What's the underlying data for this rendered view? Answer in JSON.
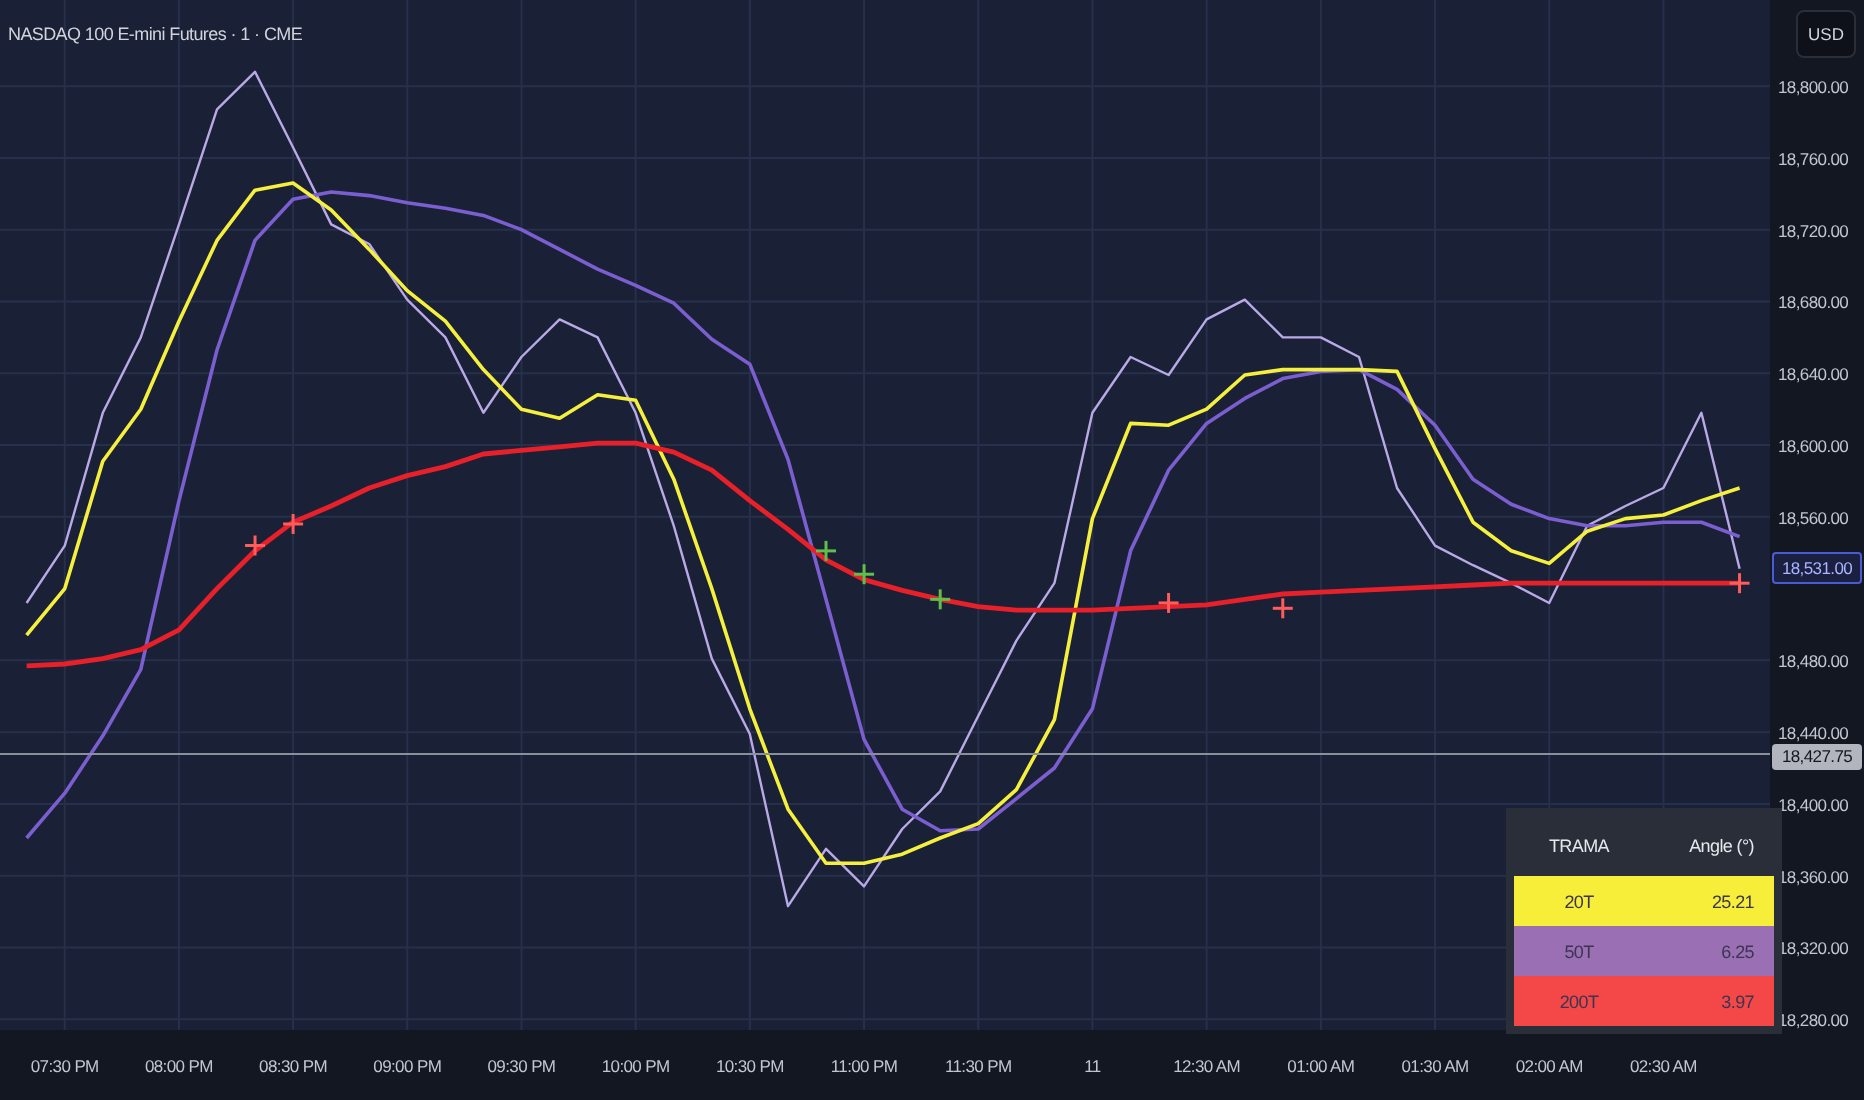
{
  "chart": {
    "title": "NASDAQ 100 E-mini Futures · 1 · CME",
    "currency_button": "USD",
    "chart_data": {
      "type": "line",
      "categories": [
        null,
        "07:30 PM",
        null,
        null,
        "08:00 PM",
        null,
        null,
        "08:30 PM",
        null,
        null,
        "09:00 PM",
        null,
        null,
        "09:30 PM",
        null,
        null,
        "10:00 PM",
        null,
        null,
        "10:30 PM",
        null,
        null,
        "11:00 PM",
        null,
        null,
        "11:30 PM",
        null,
        null,
        "11",
        null,
        null,
        "12:30 AM",
        null,
        null,
        "01:00 AM",
        null,
        null,
        "01:30 AM",
        null,
        null,
        "02:00 AM",
        null,
        null,
        "02:30 AM",
        null,
        null
      ],
      "series": [
        {
          "color": "#b9a9e6",
          "values": [
            18512,
            18544,
            18618,
            18660,
            18723,
            18787,
            18808,
            18766,
            18723,
            18712,
            18681,
            18660,
            18618,
            18649,
            18670,
            18660,
            18618,
            18555,
            18481,
            18439,
            18343,
            18375,
            18354,
            18386,
            18407,
            18449,
            18491,
            18523,
            18618,
            18649,
            18639,
            18670,
            18681,
            18660,
            18660,
            18649,
            18576,
            18544,
            18533,
            18523,
            18512,
            18555,
            18566,
            18576,
            18618,
            18531
          ]
        },
        {
          "color": "#7b5fd0",
          "values": [
            18381,
            18406,
            18438,
            18475,
            18569,
            18653,
            18714,
            18737,
            18741,
            18739,
            18735,
            18732,
            18728,
            18720,
            18709,
            18698,
            18689,
            18679,
            18659,
            18645,
            18592,
            18514,
            18436,
            18397,
            18385,
            18386,
            18403,
            18420,
            18453,
            18541,
            18586,
            18612,
            18626,
            18637,
            18641,
            18642,
            18631,
            18611,
            18581,
            18567,
            18559,
            18555,
            18555,
            18557,
            18557,
            18549
          ]
        },
        {
          "color": "#f5ef3d",
          "values": [
            18494,
            18520,
            18591,
            18620,
            18669,
            18714,
            18742,
            18746,
            18731,
            18709,
            18686,
            18669,
            18642,
            18620,
            18615,
            18628,
            18625,
            18581,
            18520,
            18453,
            18397,
            18367,
            18367,
            18372,
            18381,
            18389,
            18408,
            18447,
            18559,
            18612,
            18611,
            18620,
            18639,
            18642,
            18642,
            18642,
            18641,
            18598,
            18557,
            18541,
            18534,
            18552,
            18559,
            18561,
            18569,
            18576
          ]
        },
        {
          "color": "#e8202a",
          "values": [
            18477,
            18478,
            18481,
            18486,
            18497,
            18520,
            18541,
            18557,
            18566,
            18576,
            18583,
            18588,
            18595,
            18597,
            18599,
            18601,
            18601,
            18596,
            18586,
            18569,
            18553,
            18536,
            18525,
            18519,
            18514,
            18510,
            18508,
            18508,
            18508,
            18509,
            18510,
            18511,
            18514,
            18517,
            18518,
            18519,
            18520,
            18521,
            18522,
            18523,
            18523,
            18523,
            18523,
            18523,
            18523,
            18523
          ]
        },
        {
          "type": "scatter",
          "color": "#ff5c5c",
          "values": [
            null,
            null,
            null,
            null,
            null,
            null,
            18544,
            18556,
            null,
            null,
            null,
            null,
            null,
            null,
            null,
            null,
            null,
            null,
            null,
            null,
            null,
            null,
            null,
            null,
            null,
            null,
            null,
            null,
            null,
            null,
            18512,
            null,
            null,
            18509,
            null,
            null,
            null,
            null,
            null,
            null,
            null,
            null,
            null,
            null,
            null,
            18523
          ]
        },
        {
          "type": "scatter",
          "color": "#5fbf4a",
          "values": [
            null,
            null,
            null,
            null,
            null,
            null,
            null,
            null,
            null,
            null,
            null,
            null,
            null,
            null,
            null,
            null,
            null,
            null,
            null,
            null,
            null,
            18541,
            18528,
            null,
            18514,
            null,
            null,
            null,
            null,
            null,
            null,
            null,
            null,
            null,
            null,
            null,
            null,
            null,
            null,
            null,
            null,
            null,
            null,
            null,
            null,
            null
          ]
        }
      ],
      "ylim": [
        18274,
        18848
      ],
      "grid": true,
      "ref_lines": [
        {
          "axis": "y",
          "value": 18427.75,
          "label": "18,427.75"
        }
      ],
      "yticks": [
        {
          "value": 18280,
          "label": "18,280.00"
        },
        {
          "value": 18320,
          "label": "18,320.00"
        },
        {
          "value": 18360,
          "label": "18,360.00"
        },
        {
          "value": 18400,
          "label": "18,400.00"
        },
        {
          "value": 18440,
          "label": "18,440.00"
        },
        {
          "value": 18480,
          "label": "18,480.00"
        },
        {
          "value": 18560,
          "label": "18,560.00"
        },
        {
          "value": 18600,
          "label": "18,600.00"
        },
        {
          "value": 18640,
          "label": "18,640.00"
        },
        {
          "value": 18680,
          "label": "18,680.00"
        },
        {
          "value": 18720,
          "label": "18,720.00"
        },
        {
          "value": 18760,
          "label": "18,760.00"
        },
        {
          "value": 18800,
          "label": "18,800.00"
        }
      ]
    },
    "last_price_tag": "18,531.00"
  },
  "legend_table": {
    "columns": [
      "TRAMA",
      "Angle (°)"
    ],
    "rows": [
      {
        "label": "20T",
        "value": "25.21",
        "color": "#f7ee3a"
      },
      {
        "label": "50T",
        "value": "6.25",
        "color": "#9b6fb3"
      },
      {
        "label": "200T",
        "value": "3.97",
        "color": "#f44848"
      }
    ]
  }
}
